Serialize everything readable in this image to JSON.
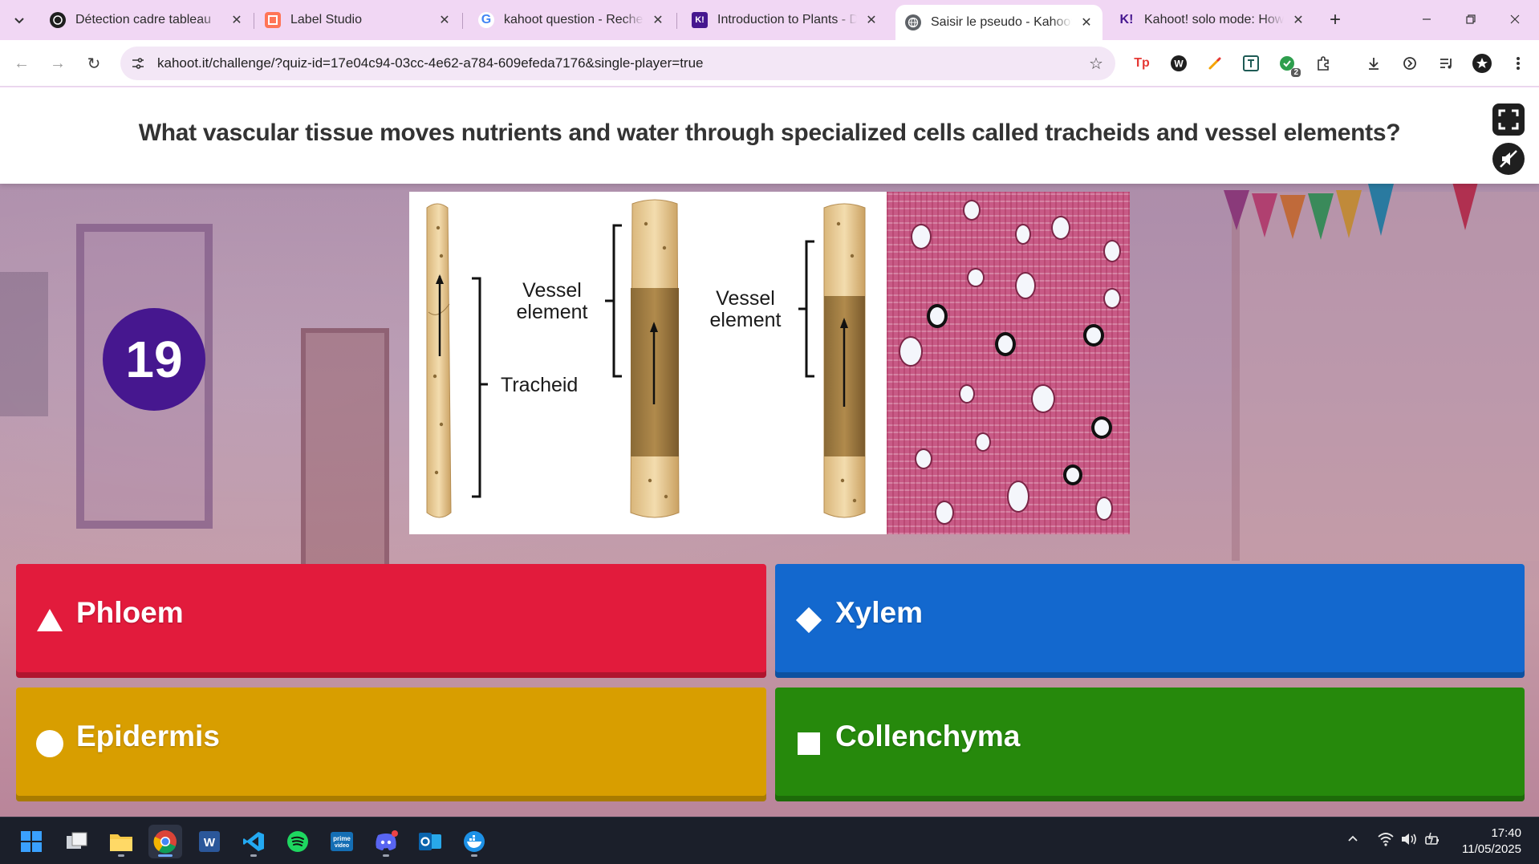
{
  "browser": {
    "tabs": [
      {
        "title": "Détection cadre tableau",
        "favicon": "openai-icon",
        "active": false
      },
      {
        "title": "Label Studio",
        "favicon": "label-studio-icon",
        "active": false
      },
      {
        "title": "kahoot question - Recherche",
        "favicon": "google-icon",
        "active": false
      },
      {
        "title": "Introduction to Plants - Dé",
        "favicon": "kahoot-icon",
        "active": false
      },
      {
        "title": "Saisir le pseudo - Kahoot!",
        "favicon": "globe-icon",
        "active": true
      },
      {
        "title": "Kahoot! solo mode: How to",
        "favicon": "kahoot-icon",
        "active": false
      }
    ],
    "address_bar": {
      "url": "kahoot.it/challenge/?quiz-id=17e04c94-03cc-4e62-a784-609efeda7176&single-player=true"
    },
    "extension_badge": "2"
  },
  "quiz": {
    "question": "What vascular tissue moves nutrients and water through specialized cells called tracheids and vessel elements?",
    "question_number": "19",
    "image_labels": {
      "vessel_element_1": "Vessel element",
      "vessel_element_2": "Vessel element",
      "tracheid": "Tracheid"
    },
    "answers": [
      {
        "label": "Phloem",
        "shape": "triangle",
        "color": "#e21b3c"
      },
      {
        "label": "Xylem",
        "shape": "diamond",
        "color": "#1368ce"
      },
      {
        "label": "Epidermis",
        "shape": "circle",
        "color": "#d89e00"
      },
      {
        "label": "Collenchyma",
        "shape": "square",
        "color": "#26890c"
      }
    ]
  },
  "taskbar": {
    "apps": [
      "windows-start",
      "task-view",
      "file-explorer",
      "chrome",
      "word",
      "vscode",
      "spotify",
      "prime-video",
      "discord",
      "outlook",
      "docker"
    ],
    "time": "17:40",
    "date": "11/05/2025"
  }
}
